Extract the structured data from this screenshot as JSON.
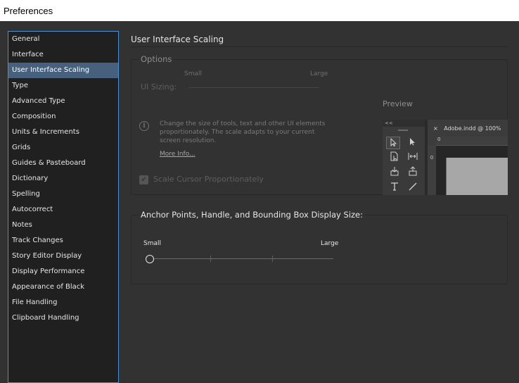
{
  "window": {
    "title": "Preferences"
  },
  "sidebar": {
    "items": [
      "General",
      "Interface",
      "User Interface Scaling",
      "Type",
      "Advanced Type",
      "Composition",
      "Units & Increments",
      "Grids",
      "Guides & Pasteboard",
      "Dictionary",
      "Spelling",
      "Autocorrect",
      "Notes",
      "Track Changes",
      "Story Editor Display",
      "Display Performance",
      "Appearance of Black",
      "File Handling",
      "Clipboard Handling"
    ],
    "selected": "User Interface Scaling"
  },
  "main": {
    "title": "User Interface Scaling",
    "options": {
      "legend": "Options",
      "ui_sizing_label": "UI Sizing:",
      "small_label": "Small",
      "large_label": "Large",
      "info_text": "Change the size of tools, text and other UI elements proportionately. The scale adapts to your current screen resolution.",
      "more_info_link": "More Info...",
      "scale_cursor_label": "Scale Cursor Proportionately",
      "scale_cursor_checked": true,
      "preview_label": "Preview",
      "preview": {
        "panel_collapse": "<<",
        "doc_tab_close": "×",
        "doc_tab_title": "Adobe.indd @ 100%",
        "ruler_zero_top": "0",
        "ruler_zero_left": "0"
      }
    },
    "anchor": {
      "legend": "Anchor Points, Handle, and Bounding Box Display Size:",
      "small_label": "Small",
      "large_label": "Large",
      "slider_position": 0,
      "slider_steps": 4
    }
  }
}
